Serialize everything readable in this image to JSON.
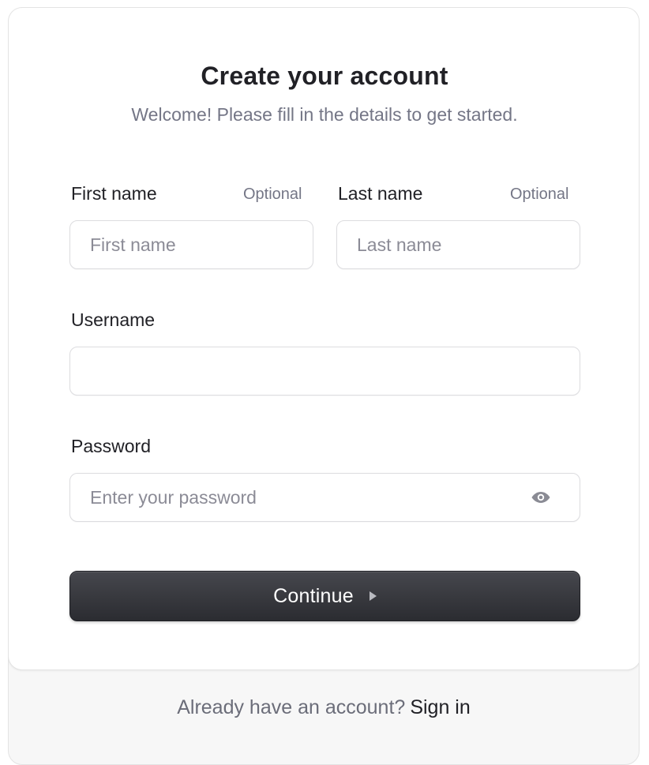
{
  "header": {
    "title": "Create your account",
    "subtitle": "Welcome! Please fill in the details to get started."
  },
  "form": {
    "first_name": {
      "label": "First name",
      "optional": "Optional",
      "placeholder": "First name",
      "value": ""
    },
    "last_name": {
      "label": "Last name",
      "optional": "Optional",
      "placeholder": "Last name",
      "value": ""
    },
    "username": {
      "label": "Username",
      "placeholder": "",
      "value": ""
    },
    "password": {
      "label": "Password",
      "placeholder": "Enter your password",
      "value": "",
      "toggle_icon": "eye-icon"
    },
    "continue_label": "Continue",
    "continue_icon": "play-arrow-icon"
  },
  "footer": {
    "prompt": "Already have an account?",
    "link": "Sign in"
  },
  "colors": {
    "primary_button": "#2f3035",
    "text": "#212126",
    "muted": "#747686",
    "border": "#dcdcdf",
    "footer_bg": "#f7f7f7"
  }
}
